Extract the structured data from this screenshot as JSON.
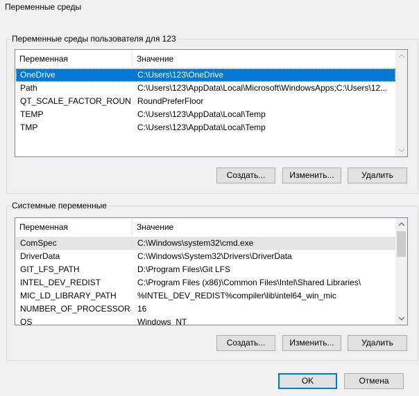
{
  "window": {
    "title": "Переменные среды"
  },
  "user_vars": {
    "group_label": "Переменные среды пользователя для 123",
    "columns": [
      "Переменная",
      "Значение"
    ],
    "rows": [
      {
        "name": "OneDrive",
        "value": "C:\\Users\\123\\OneDrive"
      },
      {
        "name": "Path",
        "value": "C:\\Users\\123\\AppData\\Local\\Microsoft\\WindowsApps;C:\\Users\\12..."
      },
      {
        "name": "QT_SCALE_FACTOR_ROUNDI...",
        "value": "RoundPreferFloor"
      },
      {
        "name": "TEMP",
        "value": "C:\\Users\\123\\AppData\\Local\\Temp"
      },
      {
        "name": "TMP",
        "value": "C:\\Users\\123\\AppData\\Local\\Temp"
      }
    ],
    "selected_index": 0,
    "buttons": {
      "create": "Создать...",
      "edit": "Изменить...",
      "delete": "Удалить"
    }
  },
  "system_vars": {
    "group_label": "Системные переменные",
    "columns": [
      "Переменная",
      "Значение"
    ],
    "rows": [
      {
        "name": "ComSpec",
        "value": "C:\\Windows\\system32\\cmd.exe"
      },
      {
        "name": "DriverData",
        "value": "C:\\Windows\\System32\\Drivers\\DriverData"
      },
      {
        "name": "GIT_LFS_PATH",
        "value": "D:\\Program Files\\Git LFS"
      },
      {
        "name": "INTEL_DEV_REDIST",
        "value": "C:\\Program Files (x86)\\Common Files\\Intel\\Shared Libraries\\"
      },
      {
        "name": "MIC_LD_LIBRARY_PATH",
        "value": "%INTEL_DEV_REDIST%compiler\\lib\\intel64_win_mic"
      },
      {
        "name": "NUMBER_OF_PROCESSORS",
        "value": "16"
      },
      {
        "name": "OS",
        "value": "Windows_NT"
      }
    ],
    "hovered_index": 0,
    "buttons": {
      "create": "Создать...",
      "edit": "Изменить...",
      "delete": "Удалить"
    }
  },
  "dialog_buttons": {
    "ok": "OK",
    "cancel": "Отмена"
  },
  "icons": {
    "scroll_up": "chevron-up-icon",
    "scroll_down": "chevron-down-icon"
  }
}
